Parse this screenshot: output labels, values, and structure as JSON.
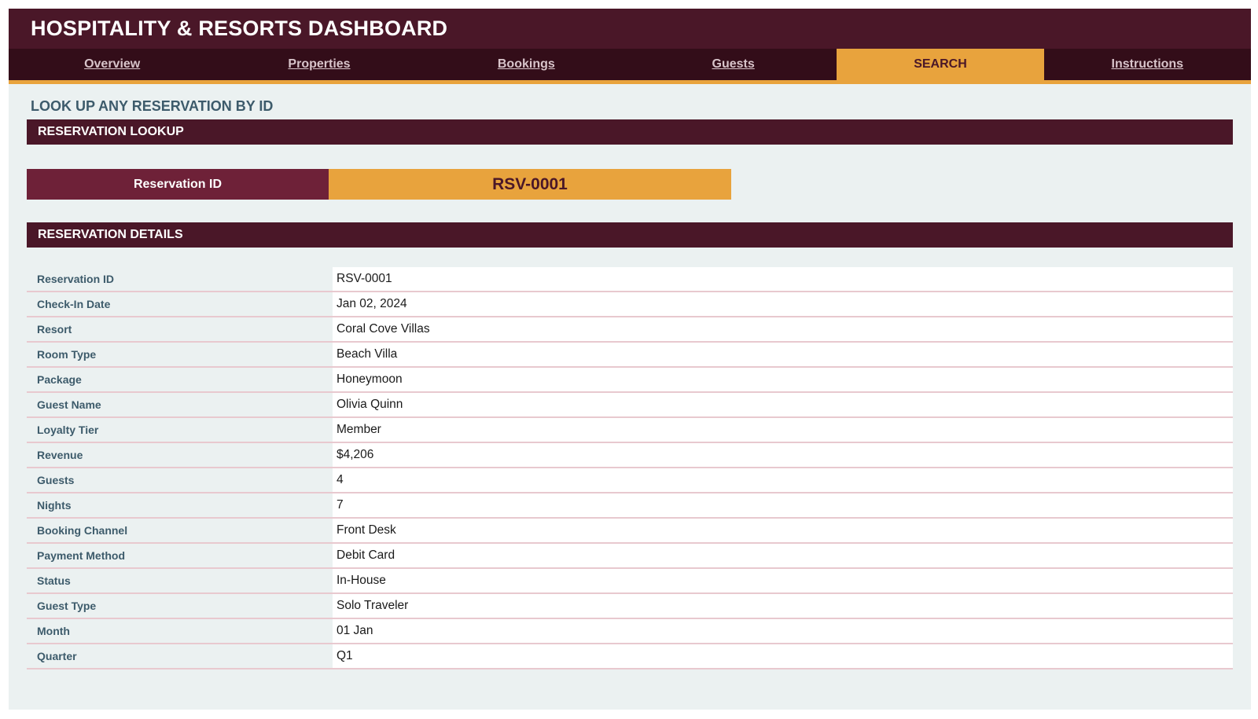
{
  "header": {
    "title": "HOSPITALITY & RESORTS DASHBOARD"
  },
  "tabs": [
    {
      "label": "Overview",
      "active": false
    },
    {
      "label": "Properties",
      "active": false
    },
    {
      "label": "Bookings",
      "active": false
    },
    {
      "label": "Guests",
      "active": false
    },
    {
      "label": "SEARCH",
      "active": true
    },
    {
      "label": "Instructions",
      "active": false
    }
  ],
  "page": {
    "subtitle": "LOOK UP ANY RESERVATION BY ID"
  },
  "lookup": {
    "section_title": "RESERVATION LOOKUP",
    "label": "Reservation ID",
    "value": "RSV-0001"
  },
  "details": {
    "section_title": "RESERVATION DETAILS",
    "rows": [
      {
        "label": "Reservation ID",
        "value": "RSV-0001"
      },
      {
        "label": "Check-In Date",
        "value": "Jan 02, 2024"
      },
      {
        "label": "Resort",
        "value": "Coral Cove Villas"
      },
      {
        "label": "Room Type",
        "value": "Beach Villa"
      },
      {
        "label": "Package",
        "value": "Honeymoon"
      },
      {
        "label": "Guest Name",
        "value": "Olivia Quinn"
      },
      {
        "label": "Loyalty Tier",
        "value": "Member"
      },
      {
        "label": "Revenue",
        "value": "$4,206"
      },
      {
        "label": "Guests",
        "value": "4"
      },
      {
        "label": "Nights",
        "value": "7"
      },
      {
        "label": "Booking Channel",
        "value": "Front Desk"
      },
      {
        "label": "Payment Method",
        "value": "Debit Card"
      },
      {
        "label": "Status",
        "value": "In-House"
      },
      {
        "label": "Guest Type",
        "value": "Solo Traveler"
      },
      {
        "label": "Month",
        "value": "01 Jan"
      },
      {
        "label": "Quarter",
        "value": "Q1"
      }
    ]
  },
  "colors": {
    "header_bg": "#4a1728",
    "tabs_bg": "#330d19",
    "accent": "#e8a33d",
    "label_bg": "#6e2138",
    "page_bg": "#ebf1f1",
    "label_text": "#3d5b6b"
  }
}
